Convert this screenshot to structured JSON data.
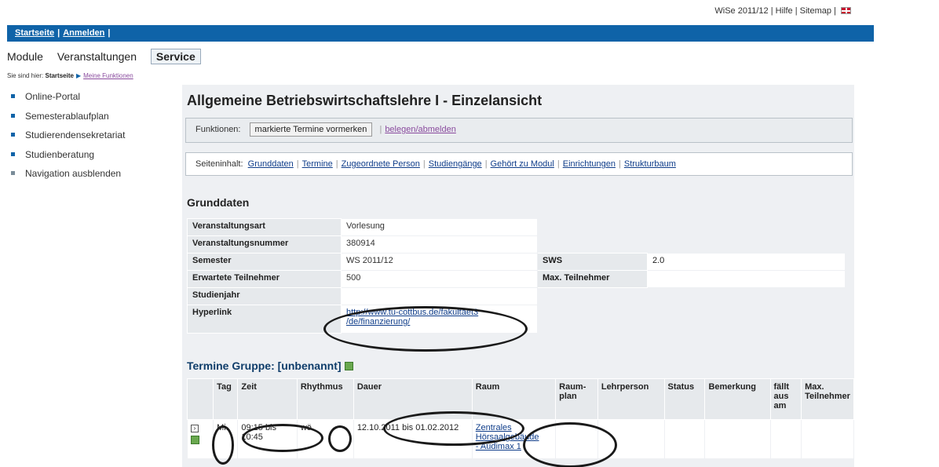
{
  "top_links": {
    "semester": "WiSe 2011/12",
    "help": "Hilfe",
    "sitemap": "Sitemap",
    "separator": "|"
  },
  "bluebar": {
    "home": "Startseite",
    "login": "Anmelden",
    "separator": "|"
  },
  "mainnav": {
    "modules": "Module",
    "events": "Veranstaltungen",
    "service": "Service"
  },
  "breadcrumb": {
    "prefix": "Sie sind hier:",
    "home": "Startseite",
    "current": "Meine Funktionen"
  },
  "sidebar": {
    "items": [
      {
        "label": "Online-Portal"
      },
      {
        "label": "Semesterablaufplan"
      },
      {
        "label": "Studierendensekretariat"
      },
      {
        "label": "Studienberatung"
      },
      {
        "label": "Navigation ausblenden"
      }
    ]
  },
  "page": {
    "title": "Allgemeine Betriebswirtschaftslehre I - Einzelansicht"
  },
  "functions": {
    "label": "Funktionen:",
    "mark_button": "markierte Termine vormerken",
    "enroll_link": "belegen/abmelden"
  },
  "page_content": {
    "label": "Seiteninhalt:",
    "links": [
      "Grunddaten",
      "Termine",
      "Zugeordnete Person",
      "Studiengänge",
      "Gehört zu Modul",
      "Einrichtungen",
      "Strukturbaum"
    ]
  },
  "grunddaten": {
    "heading": "Grunddaten",
    "rows": {
      "art_label": "Veranstaltungsart",
      "art_value": "Vorlesung",
      "nummer_label": "Veranstaltungsnummer",
      "nummer_value": "380914",
      "semester_label": "Semester",
      "semester_value": "WS 2011/12",
      "sws_label": "SWS",
      "sws_value": "2.0",
      "erwartet_label": "Erwartete Teilnehmer",
      "erwartet_value": "500",
      "max_label": "Max. Teilnehmer",
      "max_value": "",
      "jahr_label": "Studienjahr",
      "jahr_value": "",
      "hyperlink_label": "Hyperlink",
      "hyperlink_line1": "http://www.tu-cottbus.de/fakultaet3",
      "hyperlink_line2": "/de/finanzierung/"
    }
  },
  "termine": {
    "heading": "Termine Gruppe: [unbenannt]",
    "headers": {
      "tag": "Tag",
      "zeit": "Zeit",
      "rhythmus": "Rhythmus",
      "dauer": "Dauer",
      "raum": "Raum",
      "raumplan_1": "Raum-",
      "raumplan_2": "plan",
      "lehrperson": "Lehrperson",
      "status": "Status",
      "bemerkung": "Bemerkung",
      "faellt_1": "fällt",
      "faellt_2": "aus",
      "faellt_3": "am",
      "max_1": "Max.",
      "max_2": "Teilnehmer"
    },
    "row": {
      "tag": "Mi.",
      "zeit": "09:15 bis 10:45",
      "rhythmus": "wö",
      "dauer": "12.10.2011 bis 01.02.2012",
      "raum_1": "Zentrales",
      "raum_2": "Hörsaalgebäude",
      "raum_3": "- Audimax 1"
    }
  }
}
